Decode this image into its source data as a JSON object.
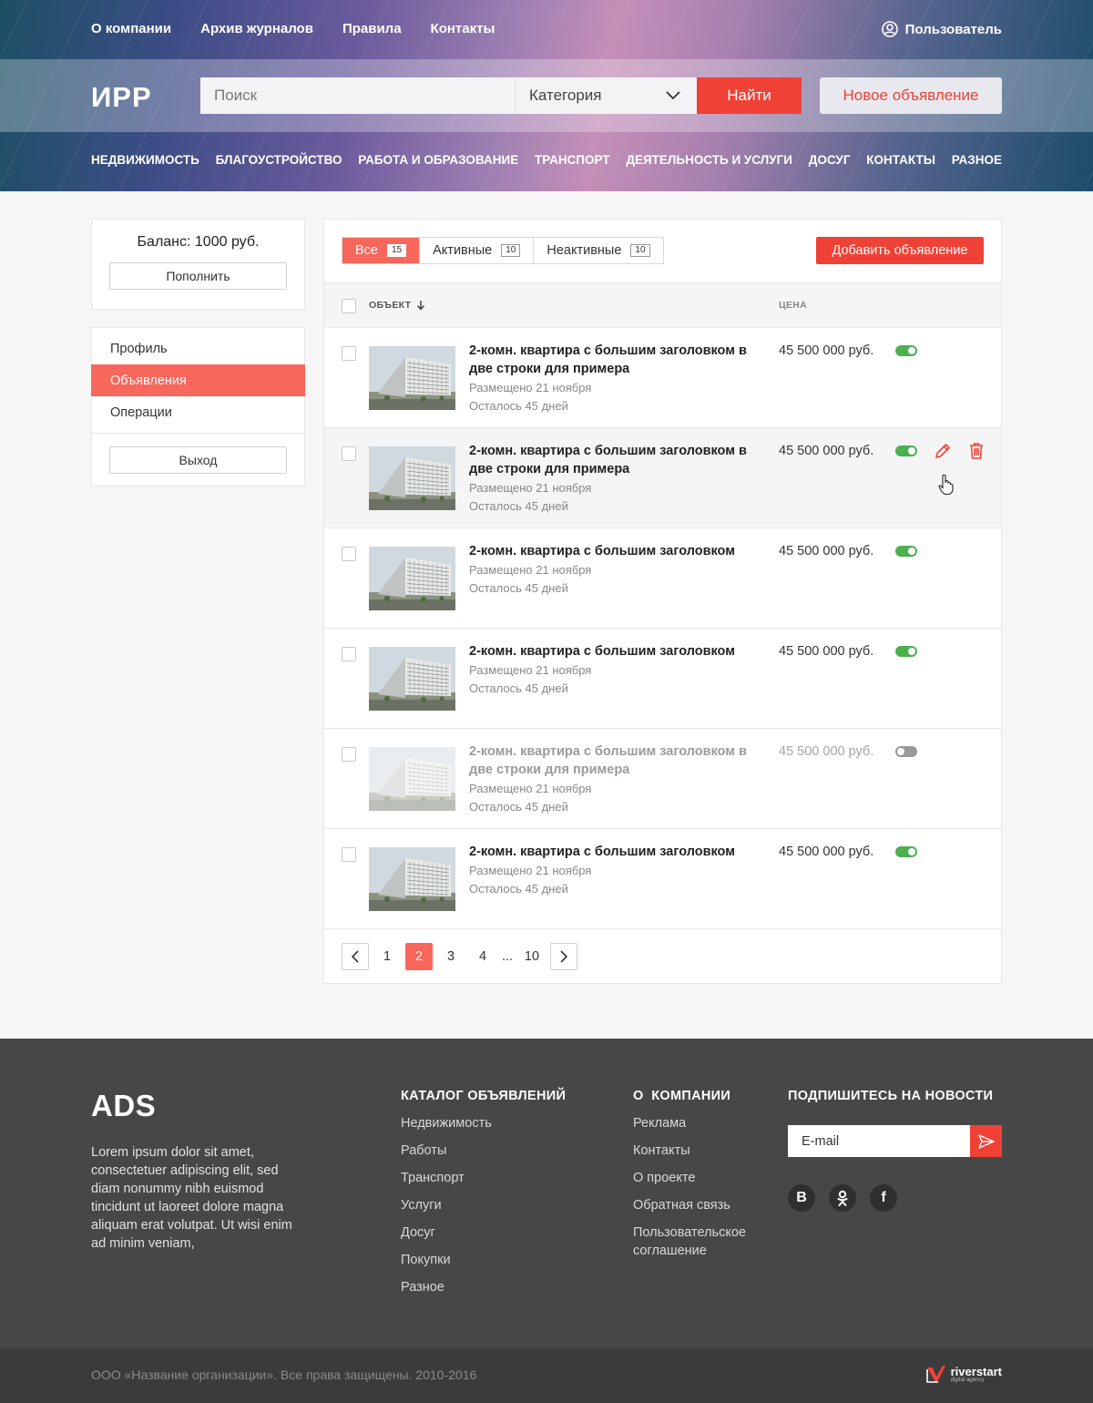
{
  "topnav": {
    "links": [
      "О компании",
      "Архив журналов",
      "Правила",
      "Контакты"
    ],
    "user_label": "Пользователь"
  },
  "header": {
    "logo": "ИРР",
    "search_placeholder": "Поиск",
    "category_label": "Категория",
    "find_label": "Найти",
    "new_ad_label": "Новое объявление"
  },
  "categories": [
    "НЕДВИЖИМОСТЬ",
    "БЛАГОУСТРОЙСТВО",
    "РАБОТА И ОБРАЗОВАНИЕ",
    "ТРАНСПОРТ",
    "ДЕЯТЕЛЬНОСТЬ И УСЛУГИ",
    "ДОСУГ",
    "КОНТАКТЫ",
    "РАЗНОЕ"
  ],
  "sidebar": {
    "balance": "Баланс: 1000 руб.",
    "topup_label": "Пополнить",
    "menu": [
      "Профиль",
      "Объявления",
      "Операции"
    ],
    "active_menu": "Объявления",
    "logout_label": "Выход"
  },
  "panel": {
    "tabs": [
      {
        "label": "Все",
        "count": "15",
        "active": true
      },
      {
        "label": "Активные",
        "count": "10",
        "active": false
      },
      {
        "label": "Неактивные",
        "count": "10",
        "active": false
      }
    ],
    "add_label": "Добавить объявление",
    "col_object": "ОБЪЕКТ",
    "col_price": "ЦЕНА",
    "ads": [
      {
        "title": "2-комн. квартира с большим заголовком в две строки для примера",
        "posted": "Размещено 21 ноября",
        "left": "Осталось 45 дней",
        "price": "45 500 000 руб.",
        "active": true
      },
      {
        "title": "2-комн. квартира с большим заголовком в две строки для примера",
        "posted": "Размещено 21 ноября",
        "left": "Осталось 45 дней",
        "price": "45 500 000 руб.",
        "active": true
      },
      {
        "title": "2-комн. квартира с большим заголовком",
        "posted": "Размещено 21 ноября",
        "left": "Осталось 45 дней",
        "price": "45 500 000 руб.",
        "active": true
      },
      {
        "title": "2-комн. квартира с большим заголовком",
        "posted": "Размещено 21 ноября",
        "left": "Осталось 45 дней",
        "price": "45 500 000 руб.",
        "active": true
      },
      {
        "title": "2-комн. квартира с большим заголовком в две строки для примера",
        "posted": "Размещено 21 ноября",
        "left": "Осталось 45 дней",
        "price": "45 500 000 руб.",
        "active": false
      },
      {
        "title": "2-комн. квартира с большим заголовком",
        "posted": "Размещено 21 ноября",
        "left": "Осталось 45 дней",
        "price": "45 500 000 руб.",
        "active": true
      }
    ],
    "pagination": {
      "pages": [
        "1",
        "2",
        "3",
        "4"
      ],
      "dots": "...",
      "last": "10",
      "current": "2"
    }
  },
  "footer": {
    "logo": "ADS",
    "text": "Lorem ipsum dolor sit amet, consectetuer adipiscing elit, sed diam nonummy nibh euismod tincidunt ut laoreet dolore magna aliquam erat volutpat. Ut wisi enim ad minim veniam,",
    "catalog_title": "КАТАЛОГ ОБЪЯВЛЕНИЙ",
    "catalog_links": [
      "Недвижимость",
      "Работы",
      "Транспорт",
      "Услуги",
      "Досуг",
      "Покупки",
      "Разное"
    ],
    "company_title": "О  КОМПАНИИ",
    "company_links": [
      "Реклама",
      "Контакты",
      "О проекте",
      "Обратная связь",
      "Пользовательское соглашение"
    ],
    "subscribe_title": "ПОДПИШИТЕСЬ НА НОВОСТИ",
    "email_placeholder": "E-mail",
    "socials": [
      "В",
      "ok",
      "f"
    ],
    "copyright": "ООО «Название организации». Все права защищены. 2010-2016",
    "agency_name": "riverstart",
    "agency_sub": "digital agency"
  },
  "colors": {
    "accent": "#f04136",
    "accent_soft": "#f7675c",
    "toggle_on": "#4caf50",
    "toggle_off": "#999999",
    "footer_bg": "#474747"
  }
}
